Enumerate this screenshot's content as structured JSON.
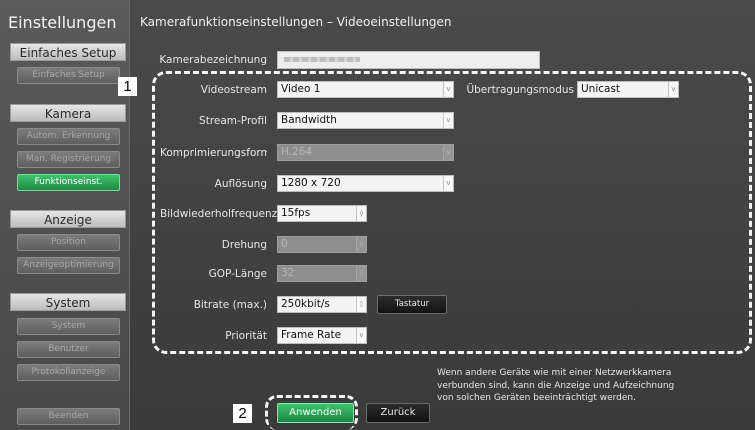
{
  "sidebar": {
    "title": "Einstellungen",
    "sections": [
      {
        "header": "Einfaches Setup",
        "items": [
          {
            "label": "Einfaches Setup",
            "active": false
          }
        ]
      },
      {
        "header": "Kamera",
        "items": [
          {
            "label": "Autom. Erkennung",
            "active": false
          },
          {
            "label": "Man. Registrierung",
            "active": false
          },
          {
            "label": "Funktionseinst.",
            "active": true
          }
        ]
      },
      {
        "header": "Anzeige",
        "items": [
          {
            "label": "Position",
            "active": false
          },
          {
            "label": "Anzeigeoptimierung",
            "active": false
          }
        ]
      },
      {
        "header": "System",
        "items": [
          {
            "label": "System",
            "active": false
          },
          {
            "label": "Benutzer",
            "active": false
          },
          {
            "label": "Protokollanzeige",
            "active": false
          }
        ]
      }
    ],
    "exit_label": "Beenden"
  },
  "page": {
    "title": "Kamerafunktionseinstellungen – Videoeinstellungen"
  },
  "camera_name": {
    "label": "Kamerabezeichnung"
  },
  "form": {
    "videostream": {
      "label": "Videostream",
      "value": "Video 1"
    },
    "transmission": {
      "label": "Übertragungsmodus",
      "value": "Unicast"
    },
    "stream_profile": {
      "label": "Stream-Profil",
      "value": "Bandwidth"
    },
    "compression": {
      "label": "Komprimierungsformat",
      "value": "H.264",
      "disabled": true
    },
    "resolution": {
      "label": "Auflösung",
      "value": "1280 x 720"
    },
    "framerate": {
      "label": "Bildwiederholfrequenz",
      "value": "15fps"
    },
    "rotation": {
      "label": "Drehung",
      "value": "0",
      "disabled": true
    },
    "gop": {
      "label": "GOP-Länge",
      "value": "32",
      "disabled": true
    },
    "bitrate": {
      "label": "Bitrate (max.)",
      "value": "250kbit/s",
      "keyboard_label": "Tastatur"
    },
    "priority": {
      "label": "Priorität",
      "value": "Frame Rate"
    }
  },
  "info": {
    "line1": "Wenn andere Geräte wie mit einer Netzwerkkamera",
    "line2": "verbunden sind, kann die Anzeige und Aufzeichnung",
    "line3": "von solchen Geräten beeinträchtigt werden."
  },
  "actions": {
    "apply_label": "Anwenden",
    "back_label": "Zurück"
  },
  "markers": {
    "m1": "1",
    "m2": "2"
  },
  "icons": {
    "dropdown": "chevron-down-icon",
    "spinner": "spinner-arrows-icon"
  },
  "colors": {
    "accent_green": "#2fb45c",
    "background": "#404040"
  }
}
